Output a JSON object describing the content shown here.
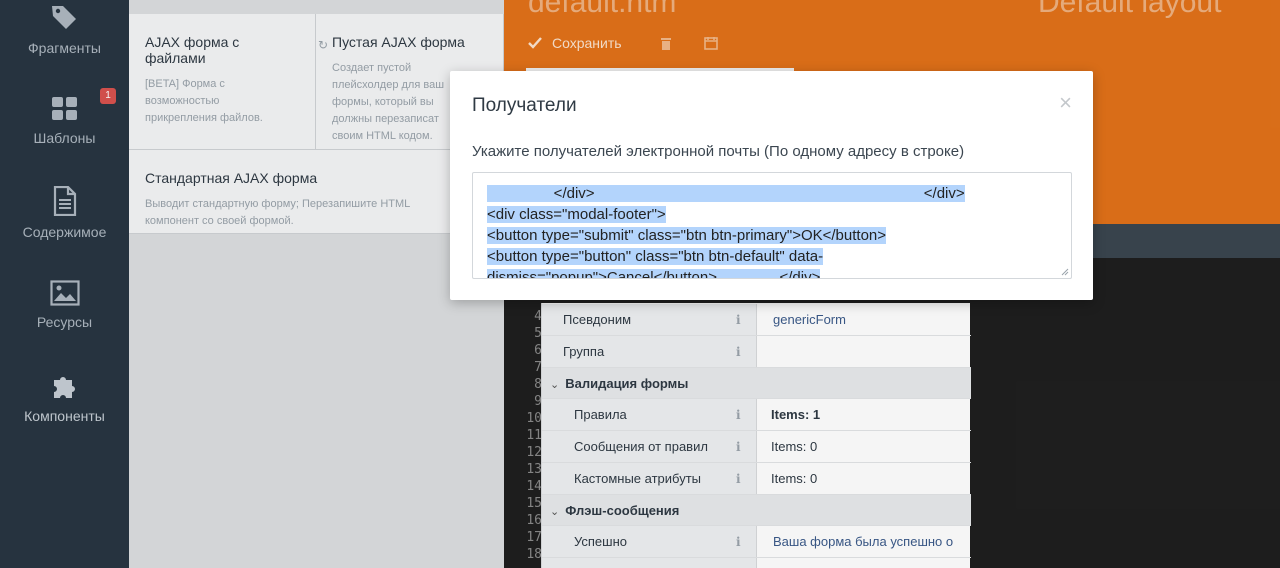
{
  "sidebar": {
    "items": [
      {
        "label": "Фрагменты",
        "icon": "tags-icon"
      },
      {
        "label": "Шаблоны",
        "icon": "grid-icon",
        "badge": "1"
      },
      {
        "label": "Содержимое",
        "icon": "document-icon"
      },
      {
        "label": "Ресурсы",
        "icon": "image-icon"
      },
      {
        "label": "Компоненты",
        "icon": "puzzle-icon"
      }
    ]
  },
  "palette": {
    "components": [
      {
        "title": "AJAX форма с файлами",
        "description": "[BETA] Форма с возможностью прикрепления файлов."
      },
      {
        "title": "Пустая AJAX форма",
        "description": "Создает пустой плейсхолдер для ваш формы, который вы должны перезаписат своим HTML кодом."
      },
      {
        "title": "Стандартная AJAX форма",
        "description": "Выводит стандартную форму; Перезапишите HTML компонент со своей формой."
      }
    ]
  },
  "header": {
    "file_name": "default.htm",
    "layout_name": "Default layout",
    "save_label": "Сохранить"
  },
  "editor": {
    "line_numbers": [
      "4",
      "5",
      "6",
      "7",
      "8",
      "9",
      "10",
      "11",
      "12",
      "13",
      "14",
      "15",
      "16",
      "17",
      "18"
    ]
  },
  "inspector": {
    "rows": [
      {
        "kind": "prop",
        "label": "Псевдоним",
        "value": "genericForm",
        "style": "link"
      },
      {
        "kind": "prop",
        "label": "Группа",
        "value": ""
      },
      {
        "kind": "group",
        "label": "Валидация формы"
      },
      {
        "kind": "prop",
        "label": "Правила",
        "value": "Items: 1",
        "style": "bold",
        "sub": true
      },
      {
        "kind": "prop",
        "label": "Сообщения от правил",
        "value": "Items: 0",
        "sub": true
      },
      {
        "kind": "prop",
        "label": "Кастомные атрибуты",
        "value": "Items: 0",
        "sub": true
      },
      {
        "kind": "group",
        "label": "Флэш-сообщения"
      },
      {
        "kind": "prop",
        "label": "Успешно",
        "value": "Ваша форма была успешно о",
        "style": "link",
        "sub": true
      }
    ]
  },
  "modal": {
    "title": "Получатели",
    "close_glyph": "×",
    "field_label": "Укажите получателей электронной почты (По одному адресу в строке)",
    "textarea_lines": [
      "                </div>                                                                               </div>",
      "<div class=\"modal-footer\">",
      "<button type=\"submit\" class=\"btn btn-primary\">OK</button>",
      "<button type=\"button\" class=\"btn btn-default\" data-",
      "dismiss=\"popup\">Cancel</button>               </div>"
    ]
  },
  "colors": {
    "sidebar": "#283642",
    "header": "#e2721a",
    "selection": "#b3d4fc"
  }
}
